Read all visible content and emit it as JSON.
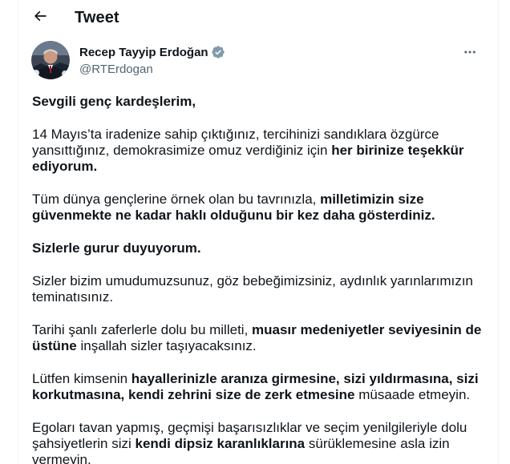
{
  "header": {
    "title": "Tweet",
    "back_icon": "arrow-left-icon"
  },
  "author": {
    "display_name": "Recep Tayyip Erdoğan",
    "handle": "@RTErdogan",
    "verified_icon": "verified-badge-icon",
    "verified_color": "#829aab"
  },
  "more_icon": "more-horizontal-icon",
  "tweet": {
    "p1": [
      {
        "text": "Sevgili genç kardeşlerim,",
        "bold": true
      }
    ],
    "p2": [
      {
        "text": "14 Mayıs’ta iradenize sahip çıktığınız, tercihinizi sandıklara özgürce yansıttığınız, demokrasimize omuz verdiğiniz için ",
        "bold": false
      },
      {
        "text": "her birinize teşekkür ediyorum.",
        "bold": true
      }
    ],
    "p3": [
      {
        "text": "Tüm dünya gençlerine örnek olan bu tavrınızla, ",
        "bold": false
      },
      {
        "text": "milletimizin size güvenmekte ne kadar haklı olduğunu bir kez daha gösterdiniz.",
        "bold": true
      }
    ],
    "p4": [
      {
        "text": "Sizlerle gurur duyuyorum.",
        "bold": true
      }
    ],
    "p5": [
      {
        "text": "Sizler bizim umudumuzsunuz, göz bebeğimizsiniz, aydınlık yarınlarımızın teminatısınız.",
        "bold": false
      }
    ],
    "p6": [
      {
        "text": "Tarihi şanlı zaferlerle dolu bu milleti, ",
        "bold": false
      },
      {
        "text": "muasır medeniyetler seviyesinin de üstüne",
        "bold": true
      },
      {
        "text": " inşallah sizler taşıyacaksınız.",
        "bold": false
      }
    ],
    "p7": [
      {
        "text": "Lütfen kimsenin ",
        "bold": false
      },
      {
        "text": "hayallerinizle aranıza girmesine, sizi yıldırmasına, sizi korkutmasına, kendi zehrini size de zerk etmesine",
        "bold": true
      },
      {
        "text": " müsaade etmeyin.",
        "bold": false
      }
    ],
    "p8": [
      {
        "text": "Egoları tavan yapmış, geçmişi başarısızlıklar ve seçim yenilgileriyle dolu şahsiyetlerin sizi ",
        "bold": false
      },
      {
        "text": "kendi dipsiz karanlıklarına",
        "bold": true
      },
      {
        "text": " sürüklemesine asla izin vermeyin.",
        "bold": false
      }
    ]
  }
}
